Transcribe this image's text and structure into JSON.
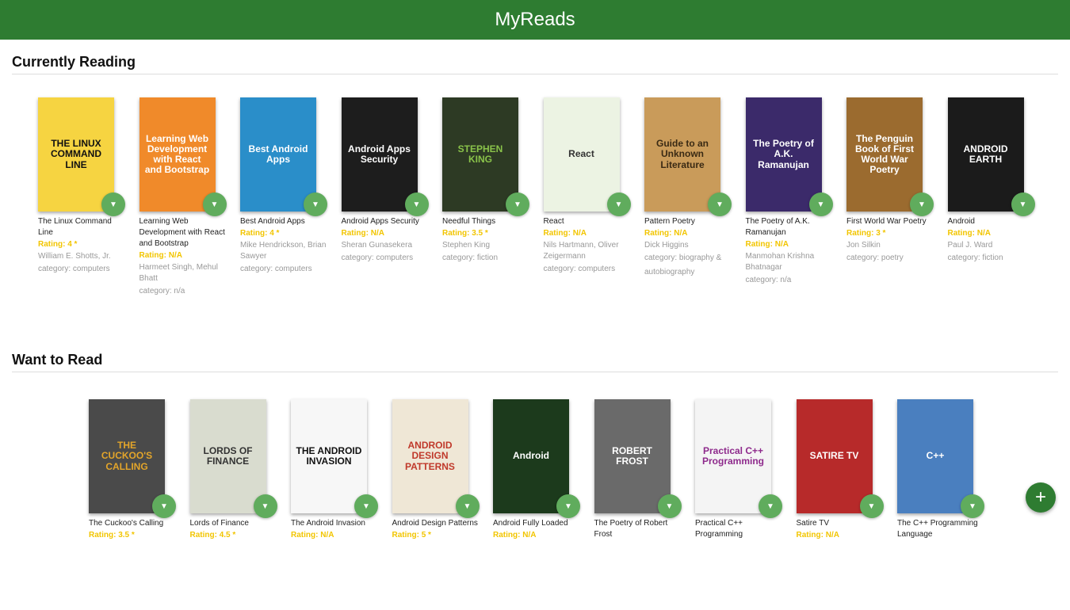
{
  "app": {
    "title": "MyReads"
  },
  "shelves": [
    {
      "title": "Currently Reading",
      "books": [
        {
          "title": "The Linux Command Line",
          "rating": "Rating: 4 *",
          "authors": "William E. Shotts, Jr.",
          "category": "category: computers",
          "cover_text": "THE LINUX COMMAND LINE",
          "cover_color": "#f6d441",
          "cover_fg": "#111"
        },
        {
          "title": "Learning Web Development with React and Bootstrap",
          "rating": "Rating: N/A",
          "authors": "Harmeet Singh, Mehul Bhatt",
          "category": "category: n/a",
          "cover_text": "Learning Web Development with React and Bootstrap",
          "cover_color": "#f08a2a",
          "cover_fg": "#fff"
        },
        {
          "title": "Best Android Apps",
          "rating": "Rating: 4 *",
          "authors": "Mike Hendrickson, Brian Sawyer",
          "category": "category: computers",
          "cover_text": "Best Android Apps",
          "cover_color": "#2a8ec9",
          "cover_fg": "#fff"
        },
        {
          "title": "Android Apps Security",
          "rating": "Rating: N/A",
          "authors": "Sheran Gunasekera",
          "category": "category: computers",
          "cover_text": "Android Apps Security",
          "cover_color": "#1d1d1d",
          "cover_fg": "#fff"
        },
        {
          "title": "Needful Things",
          "rating": "Rating: 3.5 *",
          "authors": "Stephen King",
          "category": "category: fiction",
          "cover_text": "STEPHEN KING",
          "cover_color": "#2d3a24",
          "cover_fg": "#8ac34a"
        },
        {
          "title": "React",
          "rating": "Rating: N/A",
          "authors": "Nils Hartmann, Oliver Zeigermann",
          "category": "category: computers",
          "cover_text": "React",
          "cover_color": "#ecf3e3",
          "cover_fg": "#333"
        },
        {
          "title": "Pattern Poetry",
          "rating": "Rating: N/A",
          "authors": "Dick Higgins",
          "category": "category: biography & autobiography",
          "cover_text": "Guide to an Unknown Literature",
          "cover_color": "#c99b5a",
          "cover_fg": "#3a2a14"
        },
        {
          "title": "The Poetry of A.K. Ramanujan",
          "rating": "Rating: N/A",
          "authors": "Manmohan Krishna Bhatnagar",
          "category": "category: n/a",
          "cover_text": "The Poetry of A.K. Ramanujan",
          "cover_color": "#3b2a6a",
          "cover_fg": "#fff"
        },
        {
          "title": "First World War Poetry",
          "rating": "Rating: 3 *",
          "authors": "Jon Silkin",
          "category": "category: poetry",
          "cover_text": "The Penguin Book of First World War Poetry",
          "cover_color": "#9b6b2f",
          "cover_fg": "#fff"
        },
        {
          "title": "Android",
          "rating": "Rating: N/A",
          "authors": "Paul J. Ward",
          "category": "category: fiction",
          "cover_text": "ANDROID EARTH",
          "cover_color": "#1b1b1b",
          "cover_fg": "#fff"
        }
      ]
    },
    {
      "title": "Want to Read",
      "books": [
        {
          "title": "The Cuckoo's Calling",
          "rating": "Rating: 3.5 *",
          "authors": "",
          "category": "",
          "cover_text": "THE CUCKOO'S CALLING",
          "cover_color": "#4a4a4a",
          "cover_fg": "#e3a52a"
        },
        {
          "title": "Lords of Finance",
          "rating": "Rating: 4.5 *",
          "authors": "",
          "category": "",
          "cover_text": "LORDS OF FINANCE",
          "cover_color": "#d9dccf",
          "cover_fg": "#333"
        },
        {
          "title": "The Android Invasion",
          "rating": "Rating: N/A",
          "authors": "",
          "category": "",
          "cover_text": "THE ANDROID INVASION",
          "cover_color": "#f7f7f7",
          "cover_fg": "#111"
        },
        {
          "title": "Android Design Patterns",
          "rating": "Rating: 5 *",
          "authors": "",
          "category": "",
          "cover_text": "ANDROID DESIGN PATTERNS",
          "cover_color": "#efe7d6",
          "cover_fg": "#c0392b"
        },
        {
          "title": "Android Fully Loaded",
          "rating": "Rating: N/A",
          "authors": "",
          "category": "",
          "cover_text": "Android",
          "cover_color": "#1c3a1c",
          "cover_fg": "#fff"
        },
        {
          "title": "The Poetry of Robert Frost",
          "rating": "",
          "authors": "",
          "category": "",
          "cover_text": "ROBERT FROST",
          "cover_color": "#6a6a6a",
          "cover_fg": "#fff"
        },
        {
          "title": "Practical C++ Programming",
          "rating": "",
          "authors": "",
          "category": "",
          "cover_text": "Practical C++ Programming",
          "cover_color": "#f4f4f4",
          "cover_fg": "#8e2a8c"
        },
        {
          "title": "Satire TV",
          "rating": "Rating: N/A",
          "authors": "",
          "category": "",
          "cover_text": "SATIRE TV",
          "cover_color": "#b72a2a",
          "cover_fg": "#fff"
        },
        {
          "title": "The C++ Programming Language",
          "rating": "",
          "authors": "",
          "category": "",
          "cover_text": "C++",
          "cover_color": "#4a7fbf",
          "cover_fg": "#fff"
        }
      ]
    }
  ],
  "add_button": {
    "label": "+"
  },
  "shelf_changer_icon": "▼",
  "icons": {
    "shelf_changer": "arrow-drop-down-icon",
    "add": "plus-icon"
  },
  "colors": {
    "header": "#2e7c31",
    "changer": "#60ac5d",
    "rating": "#f2c500"
  }
}
